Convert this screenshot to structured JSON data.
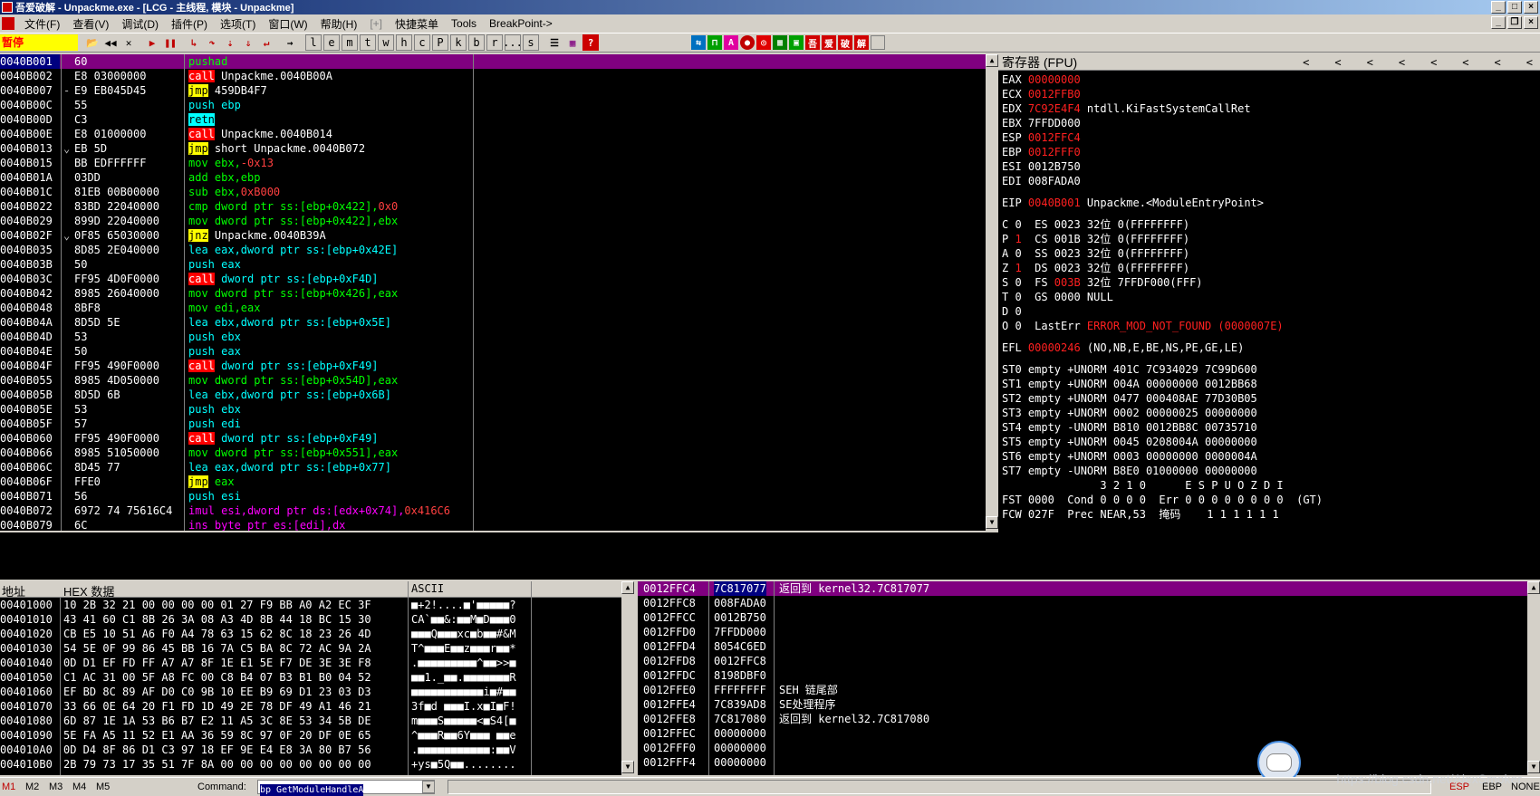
{
  "window": {
    "title": "吾爱破解 - Unpackme.exe - [LCG - 主线程, 模块 - Unpackme]"
  },
  "menu": [
    "文件(F)",
    "查看(V)",
    "调试(D)",
    "插件(P)",
    "选项(T)",
    "窗口(W)",
    "帮助(H)",
    "[+]",
    "快捷菜单",
    "Tools",
    "BreakPoint->"
  ],
  "toolbar": {
    "status": "暂停",
    "letters": [
      "l",
      "e",
      "m",
      "t",
      "w",
      "h",
      "c",
      "P",
      "k",
      "b",
      "r",
      "...",
      "s"
    ],
    "cn_buttons": [
      "吾",
      "爱",
      "破",
      "解"
    ]
  },
  "disasm": [
    {
      "addr": "0040B001",
      "hex": "60",
      "asm": [
        [
          "pushad",
          "op-mov"
        ]
      ],
      "sel": true
    },
    {
      "addr": "0040B002",
      "hex": "E8 03000000",
      "asm": [
        [
          "call",
          "op-call"
        ],
        [
          " Unpackme.0040B00A",
          "op-norm"
        ]
      ]
    },
    {
      "addr": "0040B007",
      "hex": "E9 EB045D45",
      "mark": "-",
      "asm": [
        [
          "jmp",
          "op-jmp"
        ],
        [
          " 459DB4F7",
          "op-norm"
        ]
      ]
    },
    {
      "addr": "0040B00C",
      "hex": "55",
      "asm": [
        [
          "push ebp",
          "op-push"
        ]
      ]
    },
    {
      "addr": "0040B00D",
      "hex": "C3",
      "asm": [
        [
          "retn",
          "op-ret"
        ]
      ]
    },
    {
      "addr": "0040B00E",
      "hex": "E8 01000000",
      "asm": [
        [
          "call",
          "op-call"
        ],
        [
          " Unpackme.0040B014",
          "op-norm"
        ]
      ]
    },
    {
      "addr": "0040B013",
      "hex": "EB 5D",
      "mark": "⌄",
      "asm": [
        [
          "jmp",
          "op-jmp"
        ],
        [
          " short Unpackme.0040B072",
          "op-norm"
        ]
      ]
    },
    {
      "addr": "0040B015",
      "hex": "BB EDFFFFFF",
      "asm": [
        [
          "mov ebx,",
          "op-mov"
        ],
        [
          "-0x13",
          "op-red"
        ]
      ]
    },
    {
      "addr": "0040B01A",
      "hex": "03DD",
      "asm": [
        [
          "add ebx,ebp",
          "op-mov"
        ]
      ]
    },
    {
      "addr": "0040B01C",
      "hex": "81EB 00B00000",
      "asm": [
        [
          "sub ebx,",
          "op-mov"
        ],
        [
          "0xB000",
          "op-red"
        ]
      ]
    },
    {
      "addr": "0040B022",
      "hex": "83BD 22040000",
      "asm": [
        [
          "cmp dword ptr ss:[ebp+0x422],",
          "op-mov"
        ],
        [
          "0x0",
          "op-red"
        ]
      ]
    },
    {
      "addr": "0040B029",
      "hex": "899D 22040000",
      "asm": [
        [
          "mov dword ptr ss:[ebp+0x422],ebx",
          "op-mov"
        ]
      ]
    },
    {
      "addr": "0040B02F",
      "hex": "0F85 65030000",
      "mark": "⌄",
      "asm": [
        [
          "jnz",
          "op-jcc"
        ],
        [
          " Unpackme.0040B39A",
          "op-norm"
        ]
      ]
    },
    {
      "addr": "0040B035",
      "hex": "8D85 2E040000",
      "asm": [
        [
          "lea eax,dword ptr ss:[ebp+0x42E]",
          "op-push"
        ]
      ]
    },
    {
      "addr": "0040B03B",
      "hex": "50",
      "asm": [
        [
          "push eax",
          "op-push"
        ]
      ]
    },
    {
      "addr": "0040B03C",
      "hex": "FF95 4D0F0000",
      "asm": [
        [
          "call",
          "op-call"
        ],
        [
          " dword ptr ss:[ebp+0xF4D]",
          "op-push"
        ]
      ]
    },
    {
      "addr": "0040B042",
      "hex": "8985 26040000",
      "asm": [
        [
          "mov dword ptr ss:[ebp+0x426],eax",
          "op-mov"
        ]
      ]
    },
    {
      "addr": "0040B048",
      "hex": "8BF8",
      "asm": [
        [
          "mov edi,eax",
          "op-mov"
        ]
      ]
    },
    {
      "addr": "0040B04A",
      "hex": "8D5D 5E",
      "asm": [
        [
          "lea ebx,dword ptr ss:[ebp+0x5E]",
          "op-push"
        ]
      ]
    },
    {
      "addr": "0040B04D",
      "hex": "53",
      "asm": [
        [
          "push ebx",
          "op-push"
        ]
      ]
    },
    {
      "addr": "0040B04E",
      "hex": "50",
      "asm": [
        [
          "push eax",
          "op-push"
        ]
      ]
    },
    {
      "addr": "0040B04F",
      "hex": "FF95 490F0000",
      "asm": [
        [
          "call",
          "op-call"
        ],
        [
          " dword ptr ss:[ebp+0xF49]",
          "op-push"
        ]
      ]
    },
    {
      "addr": "0040B055",
      "hex": "8985 4D050000",
      "asm": [
        [
          "mov dword ptr ss:[ebp+0x54D],eax",
          "op-mov"
        ]
      ]
    },
    {
      "addr": "0040B05B",
      "hex": "8D5D 6B",
      "asm": [
        [
          "lea ebx,dword ptr ss:[ebp+0x6B]",
          "op-push"
        ]
      ]
    },
    {
      "addr": "0040B05E",
      "hex": "53",
      "asm": [
        [
          "push ebx",
          "op-push"
        ]
      ]
    },
    {
      "addr": "0040B05F",
      "hex": "57",
      "asm": [
        [
          "push edi",
          "op-push"
        ]
      ]
    },
    {
      "addr": "0040B060",
      "hex": "FF95 490F0000",
      "asm": [
        [
          "call",
          "op-call"
        ],
        [
          " dword ptr ss:[ebp+0xF49]",
          "op-push"
        ]
      ]
    },
    {
      "addr": "0040B066",
      "hex": "8985 51050000",
      "asm": [
        [
          "mov dword ptr ss:[ebp+0x551],eax",
          "op-mov"
        ]
      ]
    },
    {
      "addr": "0040B06C",
      "hex": "8D45 77",
      "asm": [
        [
          "lea eax,dword ptr ss:[ebp+0x77]",
          "op-push"
        ]
      ]
    },
    {
      "addr": "0040B06F",
      "hex": "FFE0",
      "asm": [
        [
          "jmp",
          "op-jmp"
        ],
        [
          " eax",
          "op-mov"
        ]
      ]
    },
    {
      "addr": "0040B071",
      "hex": "56",
      "asm": [
        [
          "push esi",
          "op-push"
        ]
      ]
    },
    {
      "addr": "0040B072",
      "hex": "6972 74 75616C4",
      "asm": [
        [
          "imul ",
          "op-pink"
        ],
        [
          "esi,dword ptr ds:[edx+0x74],",
          "op-pink"
        ],
        [
          "0x416C6",
          "op-red"
        ]
      ]
    },
    {
      "addr": "0040B079",
      "hex": "6C",
      "asm": [
        [
          "ins byte ptr es:[edi],dx",
          "op-pink"
        ]
      ]
    }
  ],
  "registers": {
    "header": "寄存器 (FPU)",
    "rows": [
      [
        [
          "EAX ",
          "rn"
        ],
        [
          "00000000",
          "rv-red"
        ]
      ],
      [
        [
          "ECX ",
          "rn"
        ],
        [
          "0012FFB0",
          "rv-red"
        ]
      ],
      [
        [
          "EDX ",
          "rn"
        ],
        [
          "7C92E4F4",
          "rv-red"
        ],
        [
          " ntdll.KiFastSystemCallRet",
          "rv-white"
        ]
      ],
      [
        [
          "EBX ",
          "rn"
        ],
        [
          "7FFDD000",
          "rv-white"
        ]
      ],
      [
        [
          "ESP ",
          "rn"
        ],
        [
          "0012FFC4",
          "rv-red"
        ]
      ],
      [
        [
          "EBP ",
          "rn"
        ],
        [
          "0012FFF0",
          "rv-red"
        ]
      ],
      [
        [
          "ESI ",
          "rn"
        ],
        [
          "0012B750",
          "rv-white"
        ]
      ],
      [
        [
          "EDI ",
          "rn"
        ],
        [
          "008FADA0",
          "rv-white"
        ]
      ],
      [
        [
          "",
          "rn"
        ]
      ],
      [
        [
          "EIP ",
          "rn"
        ],
        [
          "0040B001",
          "rv-red"
        ],
        [
          " Unpackme.<ModuleEntryPoint>",
          "rv-white"
        ]
      ],
      [
        [
          "",
          "rn"
        ]
      ],
      [
        [
          "C 0  ES 0023 32位 0(FFFFFFFF)",
          "rn"
        ]
      ],
      [
        [
          "P ",
          "rn"
        ],
        [
          "1",
          "rv-red"
        ],
        [
          "  CS 001B 32位 0(FFFFFFFF)",
          "rn"
        ]
      ],
      [
        [
          "A 0  SS 0023 32位 0(FFFFFFFF)",
          "rn"
        ]
      ],
      [
        [
          "Z ",
          "rn"
        ],
        [
          "1",
          "rv-red"
        ],
        [
          "  DS 0023 32位 0(FFFFFFFF)",
          "rn"
        ]
      ],
      [
        [
          "S 0  FS ",
          "rn"
        ],
        [
          "003B",
          "rv-red"
        ],
        [
          " 32位 7FFDF000(FFF)",
          "rn"
        ]
      ],
      [
        [
          "T 0  GS 0000 NULL",
          "rn"
        ]
      ],
      [
        [
          "D 0",
          "rn"
        ]
      ],
      [
        [
          "O 0  LastErr ",
          "rn"
        ],
        [
          "ERROR_MOD_NOT_FOUND (0000007E)",
          "rv-red"
        ]
      ],
      [
        [
          "",
          "rn"
        ]
      ],
      [
        [
          "EFL ",
          "rn"
        ],
        [
          "00000246",
          "rv-red"
        ],
        [
          " (NO,NB,E,BE,NS,PE,GE,LE)",
          "rn"
        ]
      ],
      [
        [
          "",
          "rn"
        ]
      ],
      [
        [
          "ST0 empty +UNORM 401C 7C934029 7C99D600",
          "rn"
        ]
      ],
      [
        [
          "ST1 empty +UNORM 004A 00000000 0012BB68",
          "rn"
        ]
      ],
      [
        [
          "ST2 empty +UNORM 0477 000408AE 77D30B05",
          "rn"
        ]
      ],
      [
        [
          "ST3 empty +UNORM 0002 00000025 00000000",
          "rn"
        ]
      ],
      [
        [
          "ST4 empty -UNORM B810 0012BB8C 00735710",
          "rn"
        ]
      ],
      [
        [
          "ST5 empty +UNORM 0045 0208004A 00000000",
          "rn"
        ]
      ],
      [
        [
          "ST6 empty +UNORM 0003 00000000 0000004A",
          "rn"
        ]
      ],
      [
        [
          "ST7 empty -UNORM B8E0 01000000 00000000",
          "rn"
        ]
      ],
      [
        [
          "               3 2 1 0      E S P U O Z D I",
          "rn"
        ]
      ],
      [
        [
          "FST 0000  Cond 0 0 0 0  Err 0 0 0 0 0 0 0 0  (GT)",
          "rn"
        ]
      ],
      [
        [
          "FCW 027F  Prec NEAR,53  掩码    1 1 1 1 1 1",
          "rn"
        ]
      ]
    ]
  },
  "dump": {
    "header": {
      "addr": "地址",
      "hex": "HEX 数据",
      "ascii": "ASCII"
    },
    "rows": [
      [
        "00401000",
        "10 2B 32 21 00 00 00 00 01 27 F9 BB A0 A2 EC 3F",
        "■+2!....■'■■■■■?"
      ],
      [
        "00401010",
        "43 41 60 C1 8B 26 3A 08 A3 4D 8B 44 18 BC 15 30",
        "CA`■■&:■■M■D■■■0"
      ],
      [
        "00401020",
        "CB E5 10 51 A6 F0 A4 78 63 15 62 8C 18 23 26 4D",
        "■■■Q■■■xc■b■■#&M"
      ],
      [
        "00401030",
        "54 5E 0F 99 86 45 BB 16 7A C5 BA 8C 72 AC 9A 2A",
        "T^■■■E■■z■■■r■■*"
      ],
      [
        "00401040",
        "0D D1 EF FD FF A7 A7 8F 1E E1 5E F7 DE 3E 3E F8",
        ".■■■■■■■■■^■■>>■"
      ],
      [
        "00401050",
        "C1 AC 31 00 5F A8 FC 00 C8 B4 07 B3 B1 B0 04 52",
        "■■1._■■.■■■■■■■R"
      ],
      [
        "00401060",
        "EF BD 8C 89 AF D0 C0 9B 10 EE B9 69 D1 23 03 D3",
        "■■■■■■■■■■■i■#■■"
      ],
      [
        "00401070",
        "33 66 0E 64 20 F1 FD 1D 49 2E 78 DF 49 A1 46 21",
        "3f■d ■■■I.x■I■F!"
      ],
      [
        "00401080",
        "6D 87 1E 1A 53 B6 B7 E2 11 A5 3C 8E 53 34 5B DE",
        "m■■■S■■■■■<■S4[■"
      ],
      [
        "00401090",
        "5E FA A5 11 52 E1 AA 36 59 8C 97 0F 20 DF 0E 65",
        "^■■■R■■6Y■■■ ■■e"
      ],
      [
        "004010A0",
        "0D D4 8F 86 D1 C3 97 18 EF 9E E4 E8 3A 80 B7 56",
        ".■■■■■■■■■■■:■■V"
      ],
      [
        "004010B0",
        "2B 79 73 17 35 51 7F 8A 00 00 00 00 00 00 00 00",
        "+ys■5Q■■........"
      ]
    ]
  },
  "stack": [
    {
      "addr": "0012FFC4",
      "val": "7C817077",
      "cmt": "返回到 kernel32.7C817077",
      "sel": true
    },
    {
      "addr": "0012FFC8",
      "val": "008FADA0",
      "cmt": ""
    },
    {
      "addr": "0012FFCC",
      "val": "0012B750",
      "cmt": ""
    },
    {
      "addr": "0012FFD0",
      "val": "7FFDD000",
      "cmt": ""
    },
    {
      "addr": "0012FFD4",
      "val": "8054C6ED",
      "cmt": ""
    },
    {
      "addr": "0012FFD8",
      "val": "0012FFC8",
      "cmt": ""
    },
    {
      "addr": "0012FFDC",
      "val": "8198DBF0",
      "cmt": ""
    },
    {
      "addr": "0012FFE0",
      "val": "FFFFFFFF",
      "cmt": "SEH 链尾部"
    },
    {
      "addr": "0012FFE4",
      "val": "7C839AD8",
      "cmt": "SE处理程序"
    },
    {
      "addr": "0012FFE8",
      "val": "7C817080",
      "cmt": "返回到 kernel32.7C817080"
    },
    {
      "addr": "0012FFEC",
      "val": "00000000",
      "cmt": ""
    },
    {
      "addr": "0012FFF0",
      "val": "00000000",
      "cmt": ""
    },
    {
      "addr": "0012FFF4",
      "val": "00000000",
      "cmt": ""
    }
  ],
  "bottom": {
    "tabs": [
      "M1",
      "M2",
      "M3",
      "M4",
      "M5"
    ],
    "command_label": "Command:",
    "command_value": "bp GetModuleHandleA",
    "esp": "ESP",
    "ebp": "EBP",
    "none": "NONE"
  },
  "watermark": "https://blog.csdn.net/AlexSmoker"
}
